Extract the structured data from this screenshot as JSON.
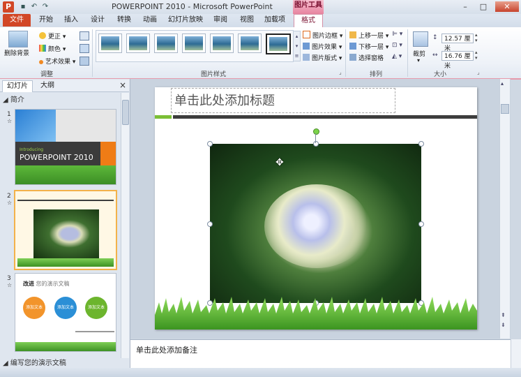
{
  "window": {
    "app_icon": "P",
    "title": "POWERPOINT 2010 - Microsoft PowerPoint",
    "context_tool": "图片工具",
    "qa_icons": [
      "save-icon",
      "undo-icon",
      "redo-icon"
    ]
  },
  "tabs": [
    {
      "label": "文件"
    },
    {
      "label": "开始"
    },
    {
      "label": "插入"
    },
    {
      "label": "设计"
    },
    {
      "label": "转换"
    },
    {
      "label": "动画"
    },
    {
      "label": "幻灯片放映"
    },
    {
      "label": "审阅"
    },
    {
      "label": "视图"
    },
    {
      "label": "加载项"
    },
    {
      "label": "格式"
    }
  ],
  "ribbon": {
    "adjust": {
      "remove_bg": "删除背景",
      "corrections": "更正",
      "color": "颜色",
      "artistic": "艺术效果",
      "label": "调整"
    },
    "styles": {
      "label": "图片样式",
      "border": "图片边框",
      "effects": "图片效果",
      "layout": "图片版式"
    },
    "arrange": {
      "label": "排列",
      "bring_forward": "上移一层",
      "send_backward": "下移一层",
      "selection_pane": "选择窗格"
    },
    "size": {
      "label": "大小",
      "crop": "裁剪",
      "height": "12.57 厘米",
      "width": "16.76 厘米"
    }
  },
  "left_pane": {
    "tab_slides": "幻灯片",
    "tab_outline": "大纲",
    "close": "×",
    "section1": "简介",
    "section2": "编写您的演示文稿",
    "slides": [
      {
        "num": "1",
        "title": "POWERPOINT 2010",
        "small": "Introducing"
      },
      {
        "num": "2"
      },
      {
        "num": "3",
        "heading": "改进",
        "heading_rest": "您的演示文稿",
        "buttons": [
          "添加文本",
          "添加文本",
          "添加文本"
        ]
      }
    ]
  },
  "slide": {
    "title_placeholder": "单击此处添加标题"
  },
  "notes": {
    "placeholder": "单击此处添加备注"
  },
  "colors": {
    "file_tab": "#d24726",
    "format_tab_accent": "#e7839f",
    "slide_bar_green": "#7bbf36",
    "thumb3_orange": "#f2942b",
    "thumb3_blue": "#2b8fd6",
    "thumb3_green": "#6cb52d"
  }
}
